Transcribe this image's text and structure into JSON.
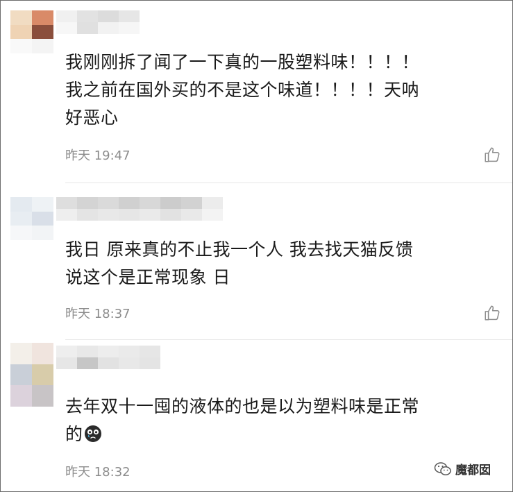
{
  "comments": [
    {
      "text": "我刚刚拆了闻了一下真的一股塑料味！！！！\n我之前在国外买的不是这个味道！！！！天呐\n好恶心",
      "time": "昨天 19:47"
    },
    {
      "text": "我日 原来真的不止我一个人 我去找天猫反馈\n说这个是正常现象 日",
      "time": "昨天 18:37"
    },
    {
      "text": "去年双十一囤的液体的也是以为塑料味是正常\n的",
      "time": "昨天 18:32"
    }
  ],
  "icons": {
    "like": "thumbs-up-icon",
    "emoji": "crying-face-icon",
    "watermark_logo": "wechat-icon"
  },
  "watermark": {
    "text": "魔都囡"
  },
  "colors": {
    "text": "#1a1a1a",
    "time": "#8c8c8c",
    "divider": "#e6e6e6"
  }
}
